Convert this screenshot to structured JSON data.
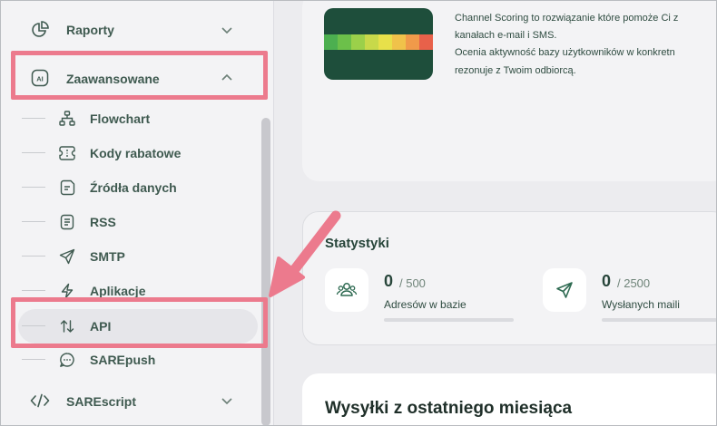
{
  "sidebar": {
    "top_items": [
      {
        "label": "Raporty",
        "icon": "pie-chart-icon"
      },
      {
        "label": "Zaawansowane",
        "icon": "ai-badge-icon"
      }
    ],
    "sub_items": [
      {
        "label": "Flowchart",
        "icon": "flowchart-icon"
      },
      {
        "label": "Kody rabatowe",
        "icon": "ticket-icon"
      },
      {
        "label": "Źródła danych",
        "icon": "data-source-icon"
      },
      {
        "label": "RSS",
        "icon": "rss-doc-icon"
      },
      {
        "label": "SMTP",
        "icon": "send-icon"
      },
      {
        "label": "Aplikacje",
        "icon": "bolt-icon"
      },
      {
        "label": "API",
        "icon": "arrows-updown-icon"
      },
      {
        "label": "SAREpush",
        "icon": "chat-bubble-icon"
      }
    ],
    "bottom_item": {
      "label": "SAREscript",
      "icon": "code-icon"
    },
    "active": "API"
  },
  "main": {
    "channel_scoring": {
      "lines": [
        "Channel Scoring to rozwiązanie które pomoże Ci z",
        "kanałach e-mail i SMS.",
        "Oceniа aktywność bazy użytkowników w konkretn",
        "rezonuje z Twoim odbiorcą."
      ],
      "scale_colors": [
        "#4caf50",
        "#6cc04a",
        "#9bd04a",
        "#c8d94a",
        "#e8e04a",
        "#f0c24a",
        "#f09a4a",
        "#e8614a"
      ]
    },
    "stats": {
      "title": "Statystyki",
      "items": [
        {
          "value": "0",
          "of": "/ 500",
          "label": "Adresów w bazie",
          "icon": "users-icon"
        },
        {
          "value": "0",
          "of": "/ 2500",
          "label": "Wysłanych maili",
          "icon": "send-icon"
        }
      ]
    },
    "monthly_title": "Wysyłki z ostatniego miesiąca"
  },
  "colors": {
    "highlight": "#ec7a8d",
    "brand_dark": "#1e4e3b"
  }
}
